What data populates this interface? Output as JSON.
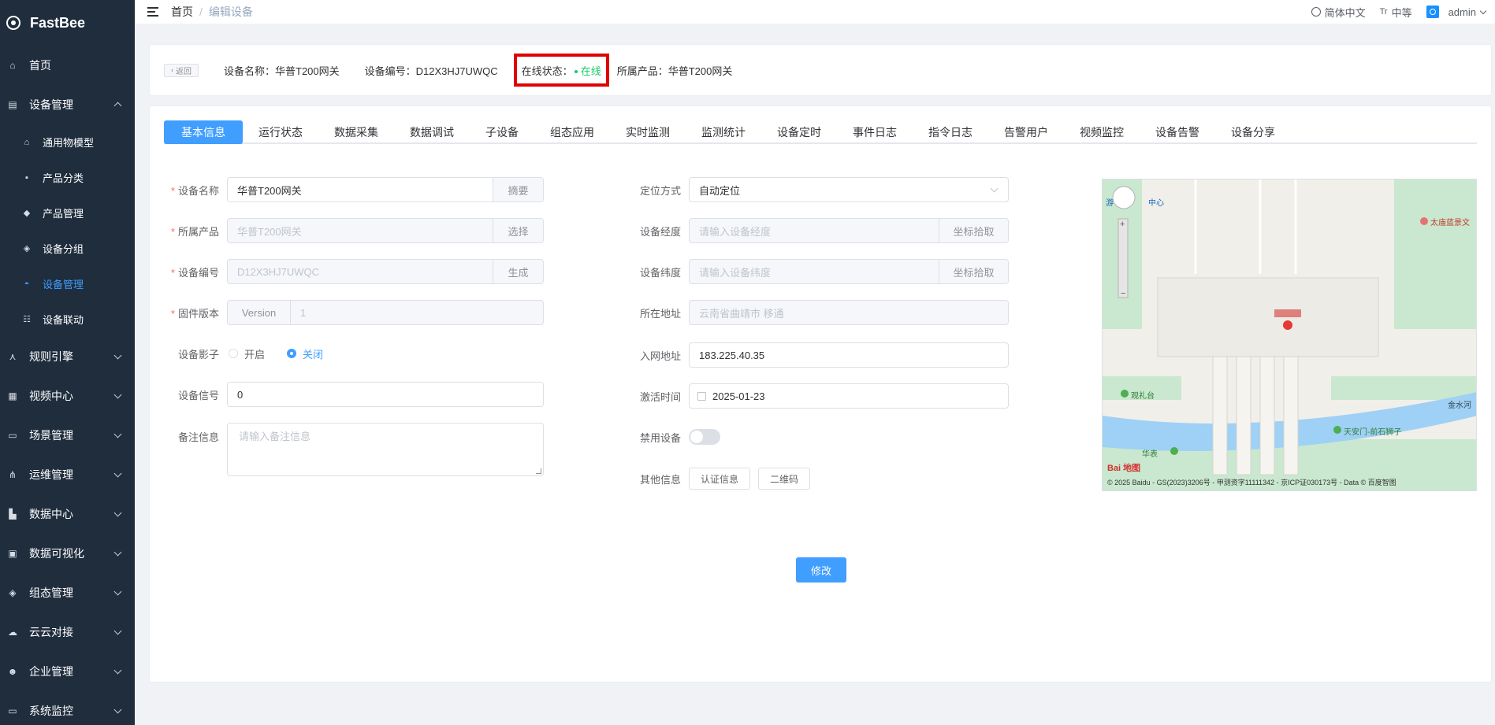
{
  "app": {
    "name": "FastBee"
  },
  "sidebar": {
    "items": [
      {
        "label": "首页",
        "icon": "home-icon",
        "glyph": "⌂"
      },
      {
        "label": "设备管理",
        "icon": "device-icon",
        "glyph": "▤",
        "expanded": true
      },
      {
        "label": "规则引擎",
        "icon": "rule-icon",
        "glyph": "⋏"
      },
      {
        "label": "视频中心",
        "icon": "grid-icon",
        "glyph": "▦"
      },
      {
        "label": "场景管理",
        "icon": "scene-icon",
        "glyph": "▭"
      },
      {
        "label": "运维管理",
        "icon": "ops-icon",
        "glyph": "⋔"
      },
      {
        "label": "数据中心",
        "icon": "chart-icon",
        "glyph": "▙"
      },
      {
        "label": "数据可视化",
        "icon": "screen-icon",
        "glyph": "▣"
      },
      {
        "label": "组态管理",
        "icon": "layers-icon",
        "glyph": "◈"
      },
      {
        "label": "云云对接",
        "icon": "cloud-icon",
        "glyph": "☁"
      },
      {
        "label": "企业管理",
        "icon": "enterprise-icon",
        "glyph": "☻"
      },
      {
        "label": "系统监控",
        "icon": "monitor-icon",
        "glyph": "▭"
      }
    ],
    "sub_items": [
      {
        "label": "通用物模型",
        "icon": "model-icon",
        "glyph": "⌂"
      },
      {
        "label": "产品分类",
        "icon": "category-icon",
        "glyph": "▪"
      },
      {
        "label": "产品管理",
        "icon": "product-icon",
        "glyph": "◆"
      },
      {
        "label": "设备分组",
        "icon": "group-icon",
        "glyph": "◈"
      },
      {
        "label": "设备管理",
        "icon": "device-mgmt-icon",
        "glyph": "◓",
        "active": true
      },
      {
        "label": "设备联动",
        "icon": "linkage-icon",
        "glyph": "☷"
      }
    ]
  },
  "navbar": {
    "breadcrumb": [
      "首页",
      "编辑设备"
    ],
    "language": "简体中文",
    "size": "中等",
    "size_glyph": "Tr",
    "user": "admin"
  },
  "header": {
    "back": "返回",
    "device_name": "设备名称：华普T200网关",
    "device_no": "设备编号：D12X3HJ7UWQC",
    "status_label": "在线状态：",
    "status_value": "在线",
    "product": "所属产品：华普T200网关"
  },
  "tabs": [
    "基本信息",
    "运行状态",
    "数据采集",
    "数据调试",
    "子设备",
    "组态应用",
    "实时监测",
    "监测统计",
    "设备定时",
    "事件日志",
    "指令日志",
    "告警用户",
    "视频监控",
    "设备告警",
    "设备分享"
  ],
  "form_left": {
    "device_name": {
      "label": "设备名称",
      "value": "华普T200网关",
      "append": "摘要"
    },
    "product": {
      "label": "所属产品",
      "value": "华普T200网关",
      "append": "选择"
    },
    "serial": {
      "label": "设备编号",
      "value": "D12X3HJ7UWQC",
      "append": "生成"
    },
    "firmware": {
      "label": "固件版本",
      "prepend": "Version",
      "value": "1"
    },
    "shadow": {
      "label": "设备影子",
      "opt_on": "开启",
      "opt_off": "关闭"
    },
    "signal": {
      "label": "设备信号",
      "value": "0"
    },
    "remark": {
      "label": "备注信息",
      "placeholder": "请输入备注信息"
    }
  },
  "form_right": {
    "locate": {
      "label": "定位方式",
      "value": "自动定位"
    },
    "longitude": {
      "label": "设备经度",
      "placeholder": "请输入设备经度",
      "append": "坐标拾取"
    },
    "latitude": {
      "label": "设备纬度",
      "placeholder": "请输入设备纬度",
      "append": "坐标拾取"
    },
    "address": {
      "label": "所在地址",
      "value": "云南省曲靖市 移通"
    },
    "ip": {
      "label": "入网地址",
      "value": "183.225.40.35"
    },
    "activate": {
      "label": "激活时间",
      "value": "2025-01-23"
    },
    "disable": {
      "label": "禁用设备"
    },
    "other": {
      "label": "其他信息",
      "btn_cert": "认证信息",
      "btn_qr": "二维码"
    }
  },
  "submit": "修改",
  "map": {
    "labels": [
      "太庙蓝景文",
      "观礼台",
      "天安门-前石狮子",
      "金水河",
      "中心",
      "游",
      "华表"
    ],
    "copyright": "© 2025 Baidu - GS(2023)3206号 - 甲测资字11111342 - 京ICP证030173号 - Data © 百度智图",
    "logo": "Bai 地图"
  }
}
